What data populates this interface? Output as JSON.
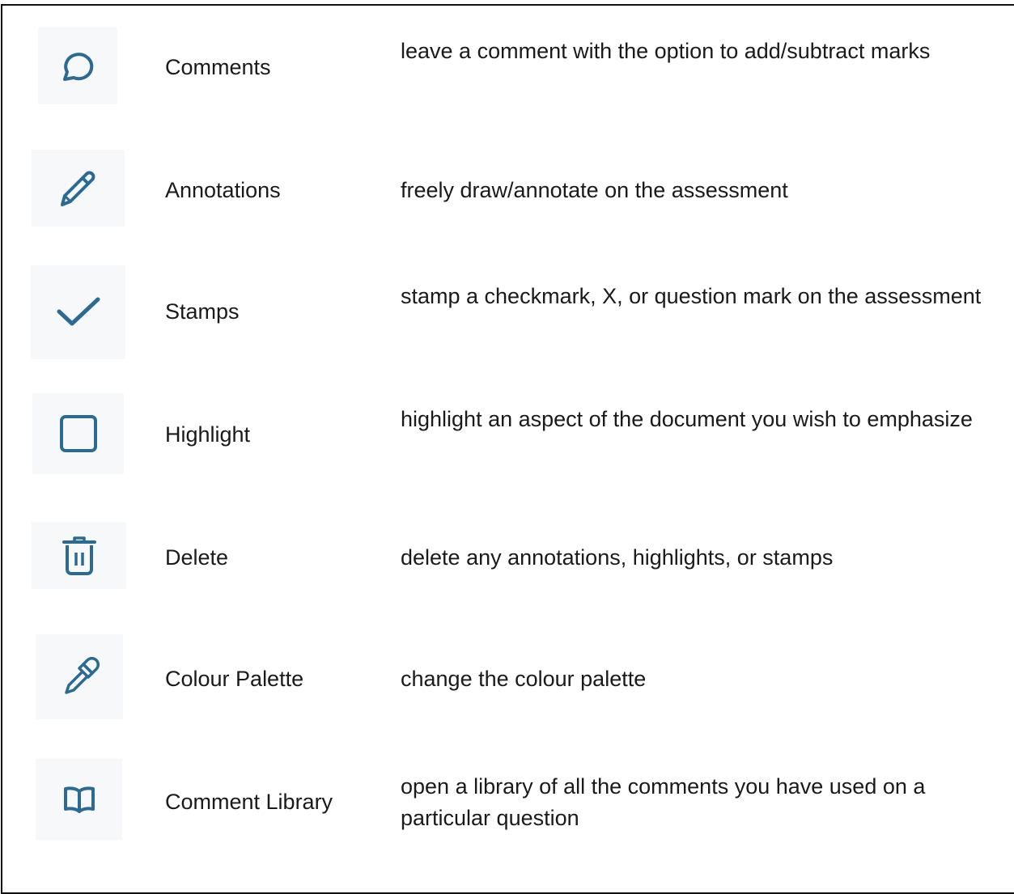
{
  "accent_color": "#2a6a93",
  "tools": [
    {
      "icon": "comment-bubble-icon",
      "label": "Comments",
      "description": "leave a comment with the option to add/subtract marks"
    },
    {
      "icon": "pencil-icon",
      "label": "Annotations",
      "description": "freely draw/annotate on the assessment"
    },
    {
      "icon": "checkmark-icon",
      "label": "Stamps",
      "description": "stamp a checkmark, X, or question mark on the assessment"
    },
    {
      "icon": "square-icon",
      "label": "Highlight",
      "description": "highlight an aspect of the document you wish to emphasize"
    },
    {
      "icon": "trash-icon",
      "label": "Delete",
      "description": "delete any annotations, highlights, or stamps"
    },
    {
      "icon": "eyedropper-icon",
      "label": "Colour Palette",
      "description": "change the colour palette"
    },
    {
      "icon": "book-icon",
      "label": "Comment Library",
      "description": "open a library of all the comments you have used on a particular question"
    }
  ]
}
